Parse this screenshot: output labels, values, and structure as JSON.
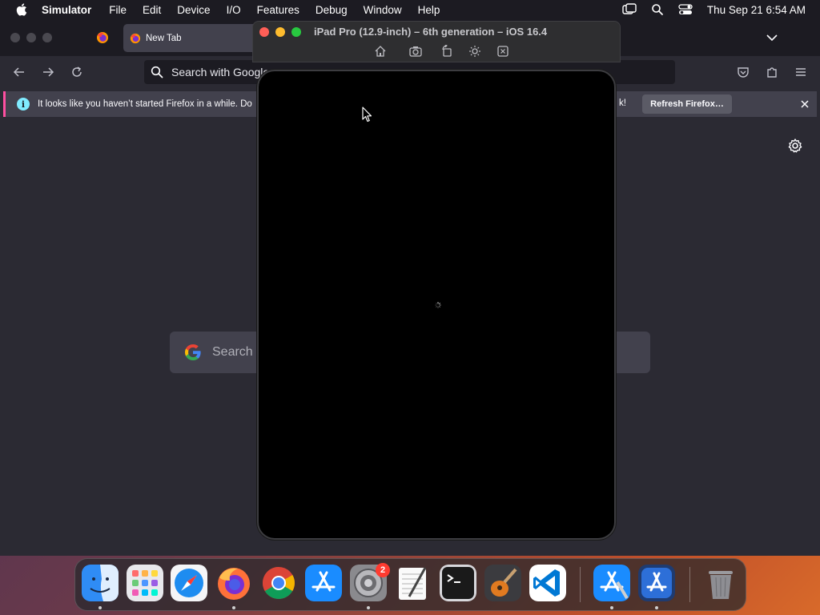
{
  "menubar": {
    "app_name": "Simulator",
    "items": [
      "File",
      "Edit",
      "Device",
      "I/O",
      "Features",
      "Debug",
      "Window",
      "Help"
    ],
    "datetime": "Thu Sep 21  6:54 AM"
  },
  "firefox": {
    "active_tab_title": "New Tab",
    "urlbar_placeholder": "Search with Google",
    "notification_message": "It looks like you haven’t started Firefox in a while. Do",
    "notification_tail": "k!",
    "refresh_button": "Refresh Firefox…",
    "search_placeholder": "Search w"
  },
  "simulator": {
    "title": "iPad Pro (12.9-inch) – 6th generation – iOS 16.4"
  },
  "dock": {
    "apps": [
      "finder",
      "launchpad",
      "safari",
      "firefox",
      "chrome",
      "app-store",
      "system-settings",
      "textedit",
      "terminal",
      "garageband",
      "vscode",
      "xcode-instruments",
      "xcode",
      "trash"
    ],
    "settings_badge": "2"
  },
  "colors": {
    "notification_accent": "#ff4fa0",
    "info_icon": "#80ebff",
    "badge_red": "#ff3b30"
  }
}
